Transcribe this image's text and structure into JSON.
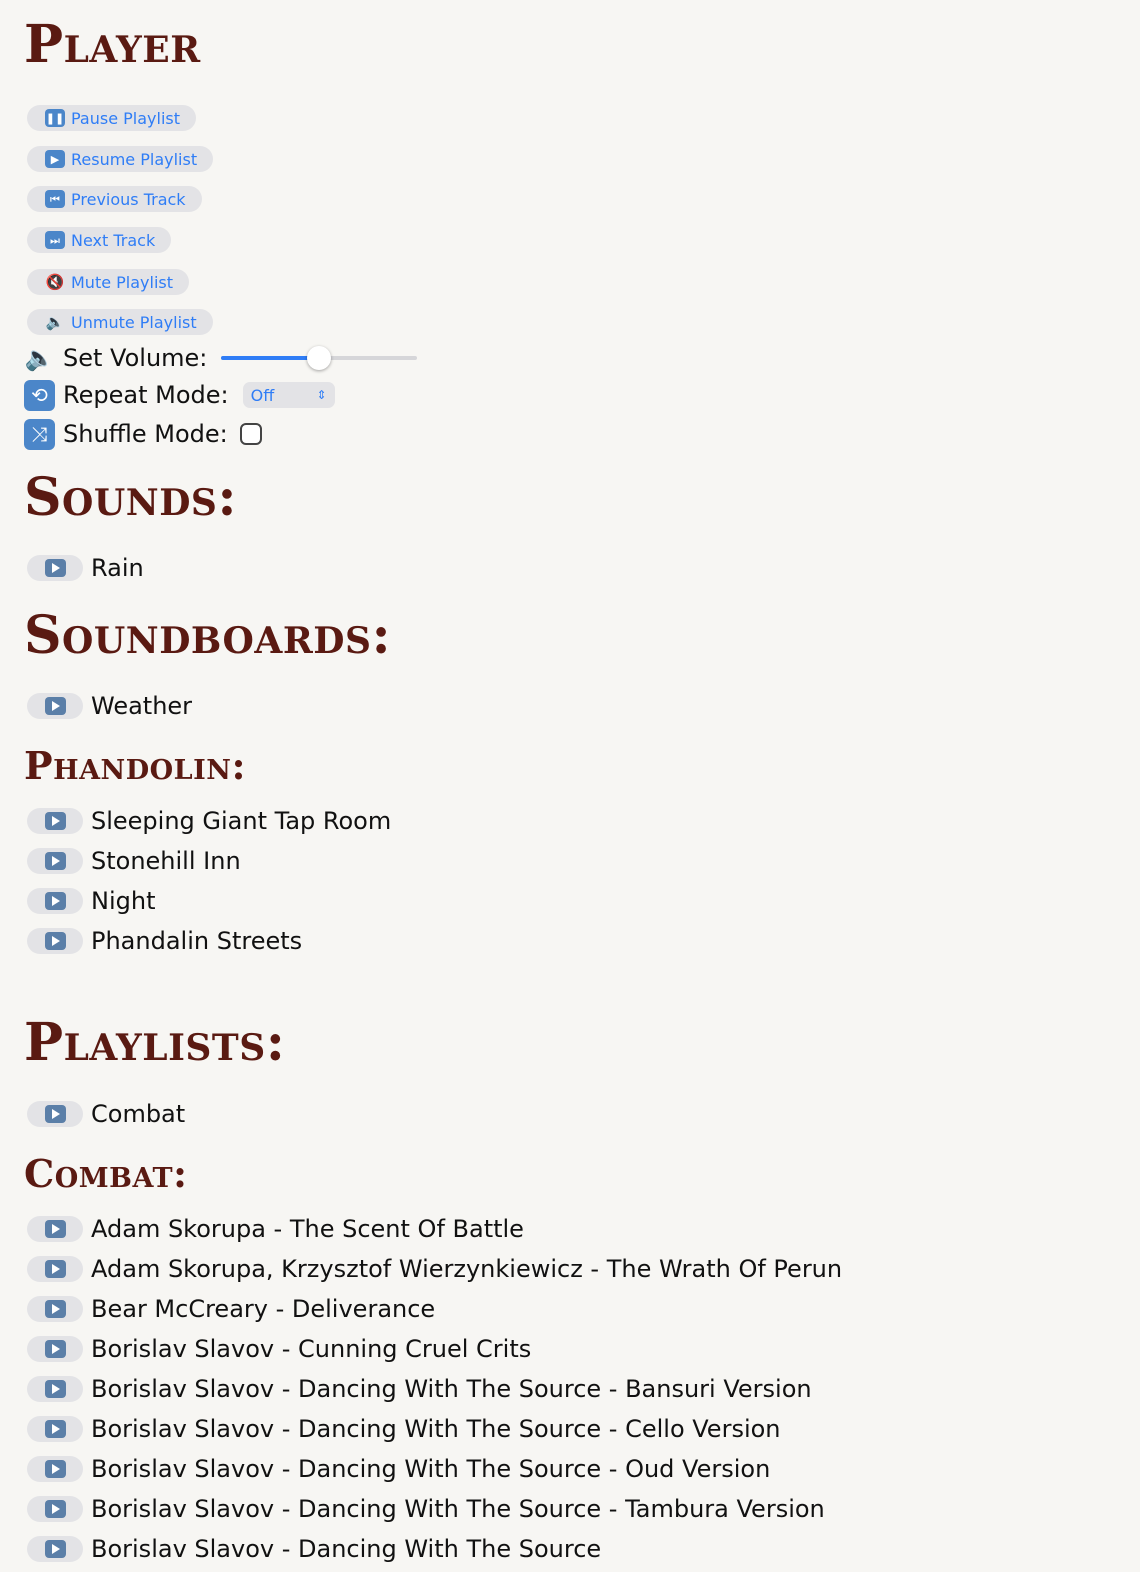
{
  "player": {
    "title": "Player",
    "buttons": [
      {
        "label": "Pause Playlist",
        "icon": "pause-icon",
        "glyph": "❚❚"
      },
      {
        "label": "Resume Playlist",
        "icon": "play-icon",
        "glyph": "▶"
      },
      {
        "label": "Previous Track",
        "icon": "previous-track-icon",
        "glyph": "⏮"
      },
      {
        "label": "Next Track",
        "icon": "next-track-icon",
        "glyph": "⏭"
      },
      {
        "label": "Mute Playlist",
        "icon": "mute-icon",
        "glyph": "🔇"
      },
      {
        "label": "Unmute Playlist",
        "icon": "speaker-icon",
        "glyph": "🔈"
      }
    ],
    "volume_label": "Set Volume:",
    "volume_level": 0.5,
    "repeat_label": "Repeat Mode:",
    "repeat_value": "Off",
    "shuffle_label": "Shuffle Mode:",
    "shuffle_checked": false
  },
  "sounds": {
    "title": "Sounds:",
    "items": [
      "Rain"
    ]
  },
  "soundboards": {
    "title": "Soundboards:",
    "items": [
      "Weather"
    ]
  },
  "phandolin": {
    "title": "Phandolin:",
    "items": [
      "Sleeping Giant Tap Room",
      "Stonehill Inn",
      "Night",
      "Phandalin Streets"
    ]
  },
  "playlists": {
    "title": "Playlists:",
    "items": [
      "Combat"
    ]
  },
  "combat": {
    "title": "Combat:",
    "items": [
      "Adam Skorupa - The Scent Of Battle",
      "Adam Skorupa, Krzysztof Wierzynkiewicz - The Wrath Of Perun",
      "Bear McCreary - Deliverance",
      "Borislav Slavov - Cunning Cruel Crits",
      "Borislav Slavov - Dancing With The Source - Bansuri Version",
      "Borislav Slavov - Dancing With The Source - Cello Version",
      "Borislav Slavov - Dancing With The Source - Oud Version",
      "Borislav Slavov - Dancing With The Source - Tambura Version",
      "Borislav Slavov - Dancing With The Source"
    ]
  }
}
